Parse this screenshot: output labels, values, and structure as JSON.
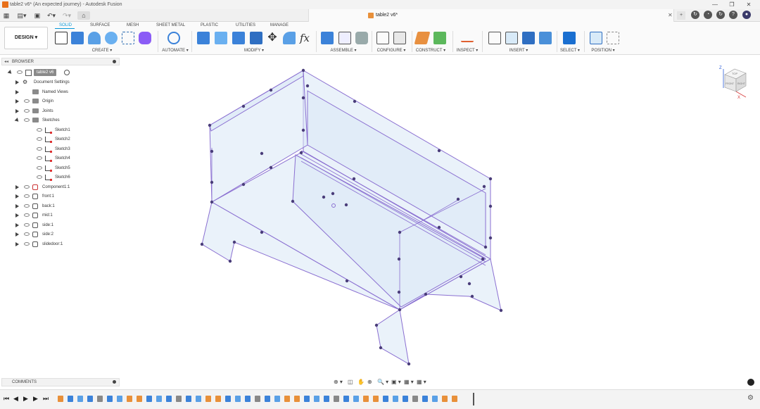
{
  "window": {
    "title": "table2 v6* (An expected journey) - Autodesk Fusion",
    "controls": [
      "—",
      "❐",
      "✕"
    ]
  },
  "document": {
    "tab_name": "table2 v6*"
  },
  "quick_access": [
    "grid-icon",
    "file-icon",
    "save-icon",
    "undo-icon",
    "redo-icon",
    "home-icon"
  ],
  "right_icons": [
    "+",
    "↻",
    "◔",
    "↻",
    "?",
    "●"
  ],
  "ribbon": {
    "workspace": "DESIGN ▾",
    "tabs": [
      "SOLID",
      "SURFACE",
      "MESH",
      "SHEET METAL",
      "PLASTIC",
      "UTILITIES",
      "MANAGE"
    ],
    "active_tab": "SOLID",
    "groups": [
      "CREATE ▾",
      "AUTOMATE ▾",
      "MODIFY ▾",
      "ASSEMBLE ▾",
      "CONFIGURE ▾",
      "CONSTRUCT ▾",
      "INSPECT ▾",
      "INSERT ▾",
      "SELECT ▾",
      "POSITION ▾"
    ],
    "fx": "fx"
  },
  "browser": {
    "title": "BROWSER",
    "root": "table2 v6",
    "items": [
      {
        "label": "Document Settings",
        "kind": "gear"
      },
      {
        "label": "Named Views",
        "kind": "folder"
      },
      {
        "label": "Origin",
        "kind": "folder"
      },
      {
        "label": "Joints",
        "kind": "folder"
      },
      {
        "label": "Sketches",
        "kind": "folder",
        "expanded": true
      },
      {
        "label": "Sketch1",
        "kind": "sketch"
      },
      {
        "label": "Sketch2",
        "kind": "sketch"
      },
      {
        "label": "Sketch3",
        "kind": "sketch"
      },
      {
        "label": "Sketch4",
        "kind": "sketch"
      },
      {
        "label": "Sketch5",
        "kind": "sketch"
      },
      {
        "label": "Sketch6",
        "kind": "sketch"
      },
      {
        "label": "Component1:1",
        "kind": "component"
      },
      {
        "label": "front:1",
        "kind": "body"
      },
      {
        "label": "back:1",
        "kind": "body"
      },
      {
        "label": "mid:1",
        "kind": "body"
      },
      {
        "label": "side:1",
        "kind": "body"
      },
      {
        "label": "side:2",
        "kind": "body"
      },
      {
        "label": "slidedoor:1",
        "kind": "body"
      }
    ]
  },
  "comments": {
    "title": "COMMENTS"
  },
  "viewcube": {
    "top": "TOP",
    "front": "FRONT",
    "right": "RIGHT",
    "axis_z": "Z",
    "axis_x": "X"
  },
  "navbar": [
    "⊕ ▾",
    "◫",
    "✋",
    "⊕",
    "🔍 ▾",
    "▣ ▾",
    "▦ ▾",
    "▦ ▾"
  ],
  "timeline": {
    "controls": [
      "⏮",
      "◀",
      "▶",
      "▶",
      "⏭"
    ],
    "settings": "⚙"
  },
  "colors": {
    "accent": "#0696d7",
    "model_face": "#dbe9f7",
    "model_edge": "#8a6fd1",
    "model_vertex": "#4a3d7a"
  }
}
